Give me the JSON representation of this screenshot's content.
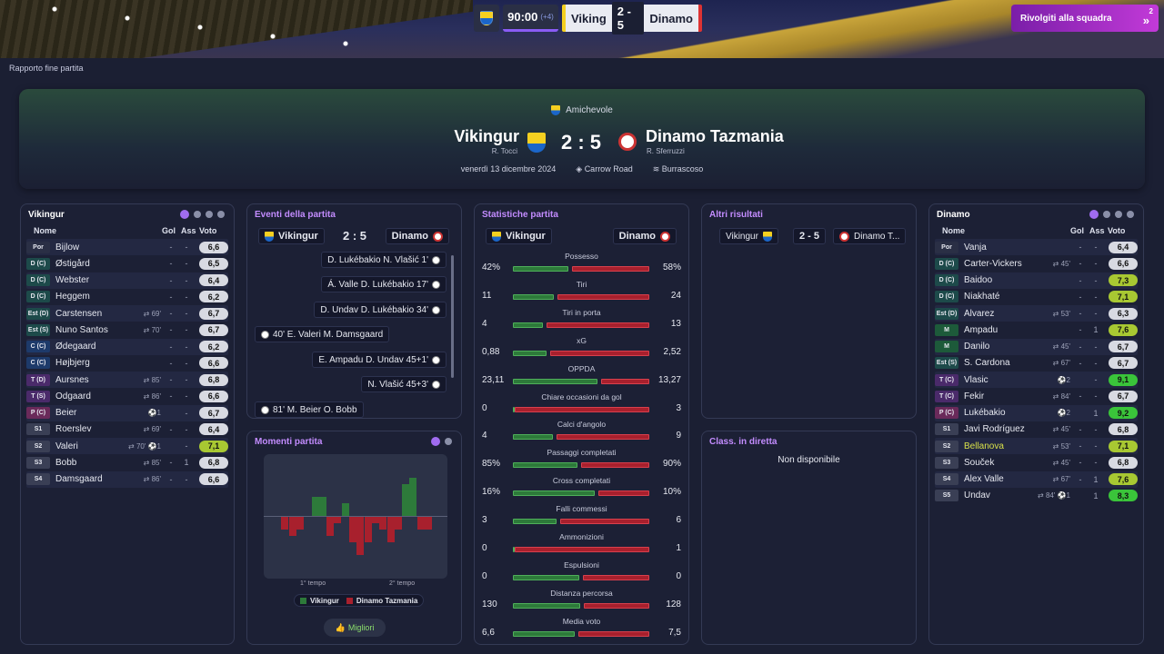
{
  "topbar": {
    "clock": "90:00",
    "added": "(+4)",
    "home": "Viking",
    "score": "2 - 5",
    "away": "Dinamo",
    "button": "Rivolgiti alla squadra",
    "notif": "2"
  },
  "breadcrumb": "Rapporto fine partita",
  "hero": {
    "competition": "Amichevole",
    "home": "Vikingur",
    "home_mgr": "R. Tocci",
    "away": "Dinamo Tazmania",
    "away_mgr": "R. Sferruzzi",
    "score": "2 : 5",
    "date": "venerdì 13 dicembre 2024",
    "stadium": "Carrow Road",
    "weather": "Burrascoso"
  },
  "headers": {
    "name": "Nome",
    "gol": "Gol",
    "ass": "Ass",
    "voto": "Voto"
  },
  "home_list": {
    "title": "Vikingur",
    "players": [
      {
        "pos": "Por",
        "name": "Bijlow",
        "sub": "",
        "gol": "-",
        "ass": "-",
        "voto": "6,6",
        "c": "#2a2f45"
      },
      {
        "pos": "D (C)",
        "name": "Østigård",
        "sub": "",
        "gol": "-",
        "ass": "-",
        "voto": "6,5",
        "c": "#1d4a4a"
      },
      {
        "pos": "D (C)",
        "name": "Webster",
        "sub": "",
        "gol": "-",
        "ass": "-",
        "voto": "6,4",
        "c": "#1d4a4a"
      },
      {
        "pos": "D (C)",
        "name": "Heggem",
        "sub": "",
        "gol": "-",
        "ass": "-",
        "voto": "6,2",
        "c": "#1d4a4a"
      },
      {
        "pos": "Est (D)",
        "name": "Carstensen",
        "sub": "⇄ 69'",
        "gol": "-",
        "ass": "-",
        "voto": "6,7",
        "c": "#1d4a4a"
      },
      {
        "pos": "Est (S)",
        "name": "Nuno Santos",
        "sub": "⇄ 70'",
        "gol": "-",
        "ass": "-",
        "voto": "6,7",
        "c": "#1d4a4a"
      },
      {
        "pos": "C (C)",
        "name": "Ødegaard",
        "sub": "",
        "gol": "-",
        "ass": "-",
        "voto": "6,2",
        "c": "#1d3a6a"
      },
      {
        "pos": "C (C)",
        "name": "Højbjerg",
        "sub": "",
        "gol": "-",
        "ass": "-",
        "voto": "6,6",
        "c": "#1d3a6a"
      },
      {
        "pos": "T (D)",
        "name": "Aursnes",
        "sub": "⇄ 85'",
        "gol": "-",
        "ass": "-",
        "voto": "6,8",
        "c": "#4a2a6a"
      },
      {
        "pos": "T (S)",
        "name": "Odgaard",
        "sub": "⇄ 86'",
        "gol": "-",
        "ass": "-",
        "voto": "6,6",
        "c": "#4a2a6a"
      },
      {
        "pos": "P (C)",
        "name": "Beier",
        "sub": "⚽1",
        "gol": "",
        "ass": "-",
        "voto": "6,7",
        "c": "#6a2a5a"
      },
      {
        "pos": "S1",
        "name": "Roerslev",
        "sub": "⇄ 69'",
        "gol": "-",
        "ass": "-",
        "voto": "6,4",
        "c": "#3a3f55"
      },
      {
        "pos": "S2",
        "name": "Valeri",
        "sub": "⇄ 70'  ⚽1",
        "gol": "",
        "ass": "-",
        "voto": "7,1",
        "c": "#3a3f55",
        "v": "g1"
      },
      {
        "pos": "S3",
        "name": "Bobb",
        "sub": "⇄ 85'",
        "gol": "-",
        "ass": "1",
        "voto": "6,8",
        "c": "#3a3f55"
      },
      {
        "pos": "S4",
        "name": "Damsgaard",
        "sub": "⇄ 86'",
        "gol": "-",
        "ass": "-",
        "voto": "6,6",
        "c": "#3a3f55"
      }
    ]
  },
  "away_list": {
    "title": "Dinamo",
    "players": [
      {
        "pos": "Por",
        "name": "Vanja",
        "sub": "",
        "gol": "-",
        "ass": "-",
        "voto": "6,4",
        "c": "#2a2f45"
      },
      {
        "pos": "D (C)",
        "name": "Carter-Vickers",
        "sub": "⇄ 45'",
        "gol": "-",
        "ass": "-",
        "voto": "6,6",
        "c": "#1d4a4a"
      },
      {
        "pos": "D (C)",
        "name": "Baidoo",
        "sub": "",
        "gol": "-",
        "ass": "-",
        "voto": "7,3",
        "c": "#1d4a4a",
        "v": "g1"
      },
      {
        "pos": "D (C)",
        "name": "Niakhaté",
        "sub": "",
        "gol": "-",
        "ass": "-",
        "voto": "7,1",
        "c": "#1d4a4a",
        "v": "g1"
      },
      {
        "pos": "Est (D)",
        "name": "Álvarez",
        "sub": "⇄ 53'",
        "gol": "-",
        "ass": "-",
        "voto": "6,3",
        "c": "#1d4a4a"
      },
      {
        "pos": "M",
        "name": "Ampadu",
        "sub": "",
        "gol": "-",
        "ass": "1",
        "voto": "7,6",
        "c": "#1d5a3a",
        "v": "g1"
      },
      {
        "pos": "M",
        "name": "Danilo",
        "sub": "⇄ 45'",
        "gol": "-",
        "ass": "-",
        "voto": "6,7",
        "c": "#1d5a3a"
      },
      {
        "pos": "Est (S)",
        "name": "S. Cardona",
        "sub": "⇄ 67'",
        "gol": "-",
        "ass": "-",
        "voto": "6,7",
        "c": "#1d4a4a"
      },
      {
        "pos": "T (C)",
        "name": "Vlasic",
        "sub": "⚽2",
        "gol": "",
        "ass": "-",
        "voto": "9,1",
        "c": "#4a2a6a",
        "v": "g2"
      },
      {
        "pos": "T (C)",
        "name": "Fekir",
        "sub": "⇄ 84'",
        "gol": "-",
        "ass": "-",
        "voto": "6,7",
        "c": "#4a2a6a"
      },
      {
        "pos": "P (C)",
        "name": "Lukébakio",
        "sub": "⚽2",
        "gol": "",
        "ass": "1",
        "voto": "9,2",
        "c": "#6a2a5a",
        "v": "g2"
      },
      {
        "pos": "S1",
        "name": "Javi Rodríguez",
        "sub": "⇄ 45'",
        "gol": "-",
        "ass": "-",
        "voto": "6,8",
        "c": "#3a3f55"
      },
      {
        "pos": "S2",
        "name": "Bellanova",
        "sub": "⇄ 53'",
        "gol": "-",
        "ass": "-",
        "voto": "7,1",
        "c": "#3a3f55",
        "v": "g1",
        "y": true
      },
      {
        "pos": "S3",
        "name": "Souček",
        "sub": "⇄ 45'",
        "gol": "-",
        "ass": "-",
        "voto": "6,8",
        "c": "#3a3f55"
      },
      {
        "pos": "S4",
        "name": "Àlex Valle",
        "sub": "⇄ 67'",
        "gol": "-",
        "ass": "1",
        "voto": "7,6",
        "c": "#3a3f55",
        "v": "g1"
      },
      {
        "pos": "S5",
        "name": "Undav",
        "sub": "⇄ 84'  ⚽1",
        "gol": "",
        "ass": "1",
        "voto": "8,3",
        "c": "#3a3f55",
        "v": "g2"
      }
    ]
  },
  "events": {
    "title": "Eventi della partita",
    "home": "Vikingur",
    "away": "Dinamo",
    "score": "2 : 5",
    "items": [
      {
        "text": "D. Lukébakio N. Vlašić 1'",
        "side": "away"
      },
      {
        "text": "Á. Valle D. Lukébakio 17'",
        "side": "away"
      },
      {
        "text": "D. Undav D. Lukébakio 34'",
        "side": "away"
      },
      {
        "text": "40' E. Valeri M. Damsgaard",
        "side": "home"
      },
      {
        "text": "E. Ampadu D. Undav 45+1'",
        "side": "away"
      },
      {
        "text": "N. Vlašić 45+3'",
        "side": "away"
      },
      {
        "text": "81' M. Beier O. Bobb",
        "side": "home"
      }
    ]
  },
  "stats": {
    "title": "Statistiche partita",
    "home": "Vikingur",
    "away": "Dinamo",
    "rows": [
      {
        "label": "Possesso",
        "h": "42%",
        "a": "58%",
        "hv": 42,
        "av": 58
      },
      {
        "label": "Tiri",
        "h": "11",
        "a": "24",
        "hv": 11,
        "av": 24
      },
      {
        "label": "Tiri in porta",
        "h": "4",
        "a": "13",
        "hv": 4,
        "av": 13
      },
      {
        "label": "xG",
        "h": "0,88",
        "a": "2,52",
        "hv": 0.88,
        "av": 2.52
      },
      {
        "label": "OPPDA",
        "h": "23,11",
        "a": "13,27",
        "hv": 23.11,
        "av": 13.27
      },
      {
        "label": "Chiare occasioni da gol",
        "h": "0",
        "a": "3",
        "hv": 0,
        "av": 3
      },
      {
        "label": "Calci d'angolo",
        "h": "4",
        "a": "9",
        "hv": 4,
        "av": 9
      },
      {
        "label": "Passaggi completati",
        "h": "85%",
        "a": "90%",
        "hv": 85,
        "av": 90
      },
      {
        "label": "Cross completati",
        "h": "16%",
        "a": "10%",
        "hv": 16,
        "av": 10
      },
      {
        "label": "Falli commessi",
        "h": "3",
        "a": "6",
        "hv": 3,
        "av": 6
      },
      {
        "label": "Ammonizioni",
        "h": "0",
        "a": "1",
        "hv": 0,
        "av": 1
      },
      {
        "label": "Espulsioni",
        "h": "0",
        "a": "0",
        "hv": 0,
        "av": 0
      },
      {
        "label": "Distanza percorsa",
        "h": "130",
        "a": "128",
        "hv": 130,
        "av": 128
      },
      {
        "label": "Media voto",
        "h": "6,6",
        "a": "7,5",
        "hv": 6.6,
        "av": 7.5
      }
    ]
  },
  "moments": {
    "title": "Momenti partita",
    "xlabel1": "1° tempo",
    "xlabel2": "2° tempo",
    "leg_home": "Vikingur",
    "leg_away": "Dinamo Tazmania",
    "button": "Migliori",
    "values": [
      0,
      -2,
      -3,
      -2,
      0,
      3,
      3,
      -3,
      -1,
      2,
      -4,
      -6,
      -4,
      -1,
      -2,
      -4,
      -2,
      5,
      6,
      -2,
      -2,
      0
    ]
  },
  "others": {
    "title": "Altri risultati",
    "home": "Vikingur",
    "score": "2 - 5",
    "away": "Dinamo T..."
  },
  "live": {
    "title": "Class. in diretta",
    "text": "Non disponibile"
  },
  "colors": {
    "accent": "#a06cf0",
    "home": "#2d7a3a",
    "away": "#a8202d"
  }
}
